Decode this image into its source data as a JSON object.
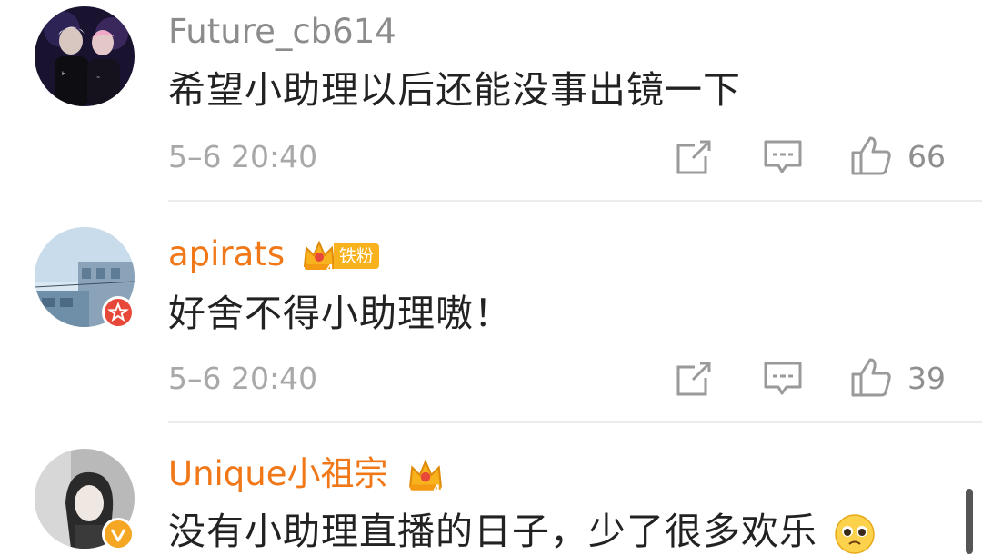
{
  "comments": [
    {
      "username": "Future_cb614",
      "text": "希望小助理以后还能没事出镜一下",
      "time": "5–6 20:40",
      "likes": "66"
    },
    {
      "username": "apirats",
      "badge_label": "铁粉",
      "text": "好舍不得小助理嗷！",
      "time": "5–6 20:40",
      "likes": "39"
    },
    {
      "username": "Unique小祖宗",
      "text": "没有小助理直播的日子，少了很多欢乐"
    }
  ],
  "icons": {
    "forward": "share-forward-icon",
    "comment": "comment-bubble-icon",
    "like": "thumbs-up-icon",
    "vip": "crown-vip-icon",
    "emoji": "pleading-face-emoji"
  },
  "colors": {
    "vip_username": "#f07818",
    "badge": "#f8b21d",
    "verify_red": "#e8483a",
    "verify_gold": "#f5a623"
  }
}
